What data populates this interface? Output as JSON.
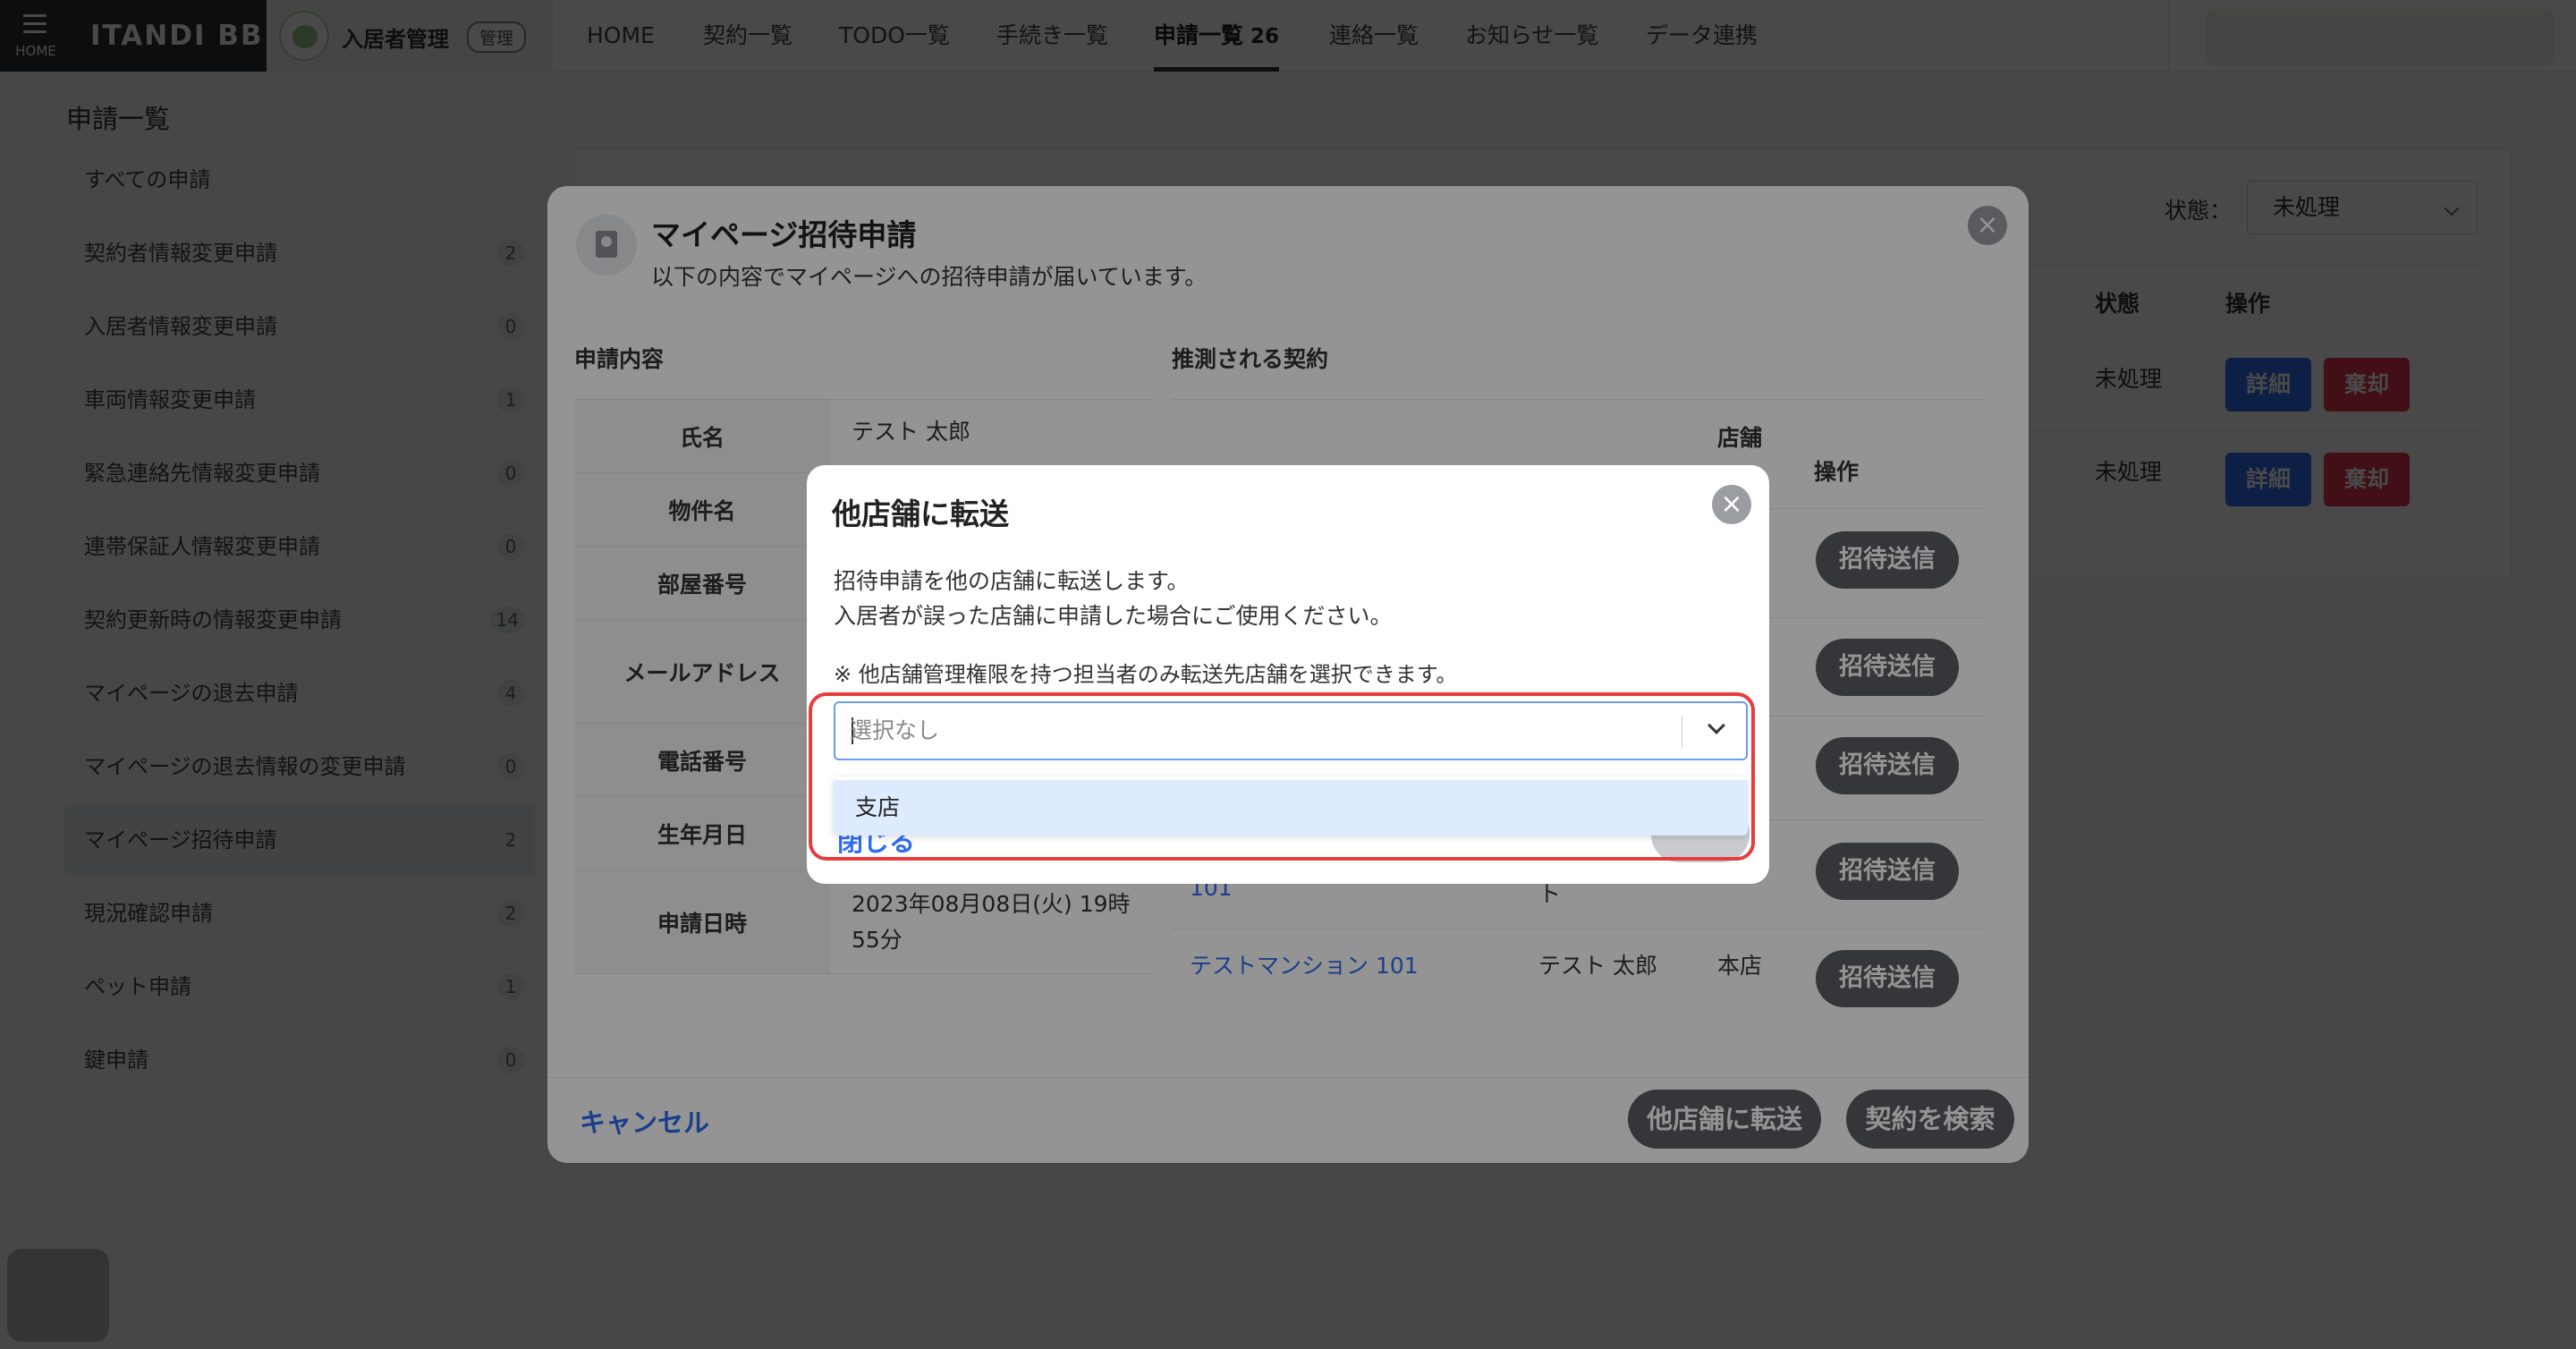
{
  "topnav": {
    "home_label": "HOME",
    "brand": "ITANDI BB",
    "app_name": "入居者管理",
    "app_badge": "管理",
    "items": [
      {
        "label": "HOME"
      },
      {
        "label": "契約一覧"
      },
      {
        "label": "TODO一覧"
      },
      {
        "label": "手続き一覧"
      },
      {
        "label": "申請一覧",
        "count": "26"
      },
      {
        "label": "連絡一覧"
      },
      {
        "label": "お知らせ一覧"
      },
      {
        "label": "データ連携"
      }
    ]
  },
  "sidebar": {
    "title": "申請一覧",
    "items": [
      {
        "label": "すべての申請",
        "count": ""
      },
      {
        "label": "契約者情報変更申請",
        "count": "2"
      },
      {
        "label": "入居者情報変更申請",
        "count": "0"
      },
      {
        "label": "車両情報変更申請",
        "count": "1"
      },
      {
        "label": "緊急連絡先情報変更申請",
        "count": "0"
      },
      {
        "label": "連帯保証人情報変更申請",
        "count": "0"
      },
      {
        "label": "契約更新時の情報変更申請",
        "count": "14"
      },
      {
        "label": "マイページの退去申請",
        "count": "4"
      },
      {
        "label": "マイページの退去情報の変更申請",
        "count": "0"
      },
      {
        "label": "マイページ招待申請",
        "count": "2"
      },
      {
        "label": "現況確認申請",
        "count": "2"
      },
      {
        "label": "ペット申請",
        "count": "1"
      },
      {
        "label": "鍵申請",
        "count": "0"
      }
    ]
  },
  "list": {
    "state_label": "状態：",
    "state_value": "未処理",
    "col_state": "状態",
    "col_action": "操作",
    "rows": [
      {
        "state": "未処理",
        "detail": "詳細",
        "reject": "棄却"
      },
      {
        "state": "未処理",
        "detail": "詳細",
        "reject": "棄却"
      }
    ]
  },
  "modal1": {
    "title": "マイページ招待申請",
    "subtitle": "以下の内容でマイページへの招待申請が届いています。",
    "section_left": "申請内容",
    "section_right": "推測される契約",
    "fields": [
      {
        "label": "氏名",
        "value": "テスト 太郎"
      },
      {
        "label": "物件名",
        "value": ""
      },
      {
        "label": "部屋番号",
        "value": ""
      },
      {
        "label": "メールアドレス",
        "value": ""
      },
      {
        "label": "電話番号",
        "value": ""
      },
      {
        "label": "生年月日",
        "value": ""
      },
      {
        "label": "申請日時",
        "value": "2023年08月08日(火) 19時55分"
      }
    ],
    "contract_header_store": "店舗",
    "contract_header_action": "操作",
    "invite_label": "招待送信",
    "contract_fragment_link": "101",
    "contract_fragment_name": "ト",
    "contract_last": {
      "property": "テストマンション 101",
      "name": "テスト 太郎",
      "store": "本店"
    },
    "cancel_label": "キャンセル",
    "transfer_label": "他店舗に転送",
    "search_label": "契約を検索"
  },
  "modal2": {
    "title": "他店舗に転送",
    "desc_line1": "招待申請を他の店舗に転送します。",
    "desc_line2": "入居者が誤った店舗に申請した場合にご使用ください。",
    "note": "※ 他店舗管理権限を持つ担当者のみ転送先店舗を選択できます。",
    "select_placeholder": "選択なし",
    "option": "支店",
    "behind_link": "閉じる"
  },
  "colors": {
    "accent_blue": "#2f6cf0",
    "danger_red": "#e0344b",
    "highlight_red": "#e63c3c"
  }
}
